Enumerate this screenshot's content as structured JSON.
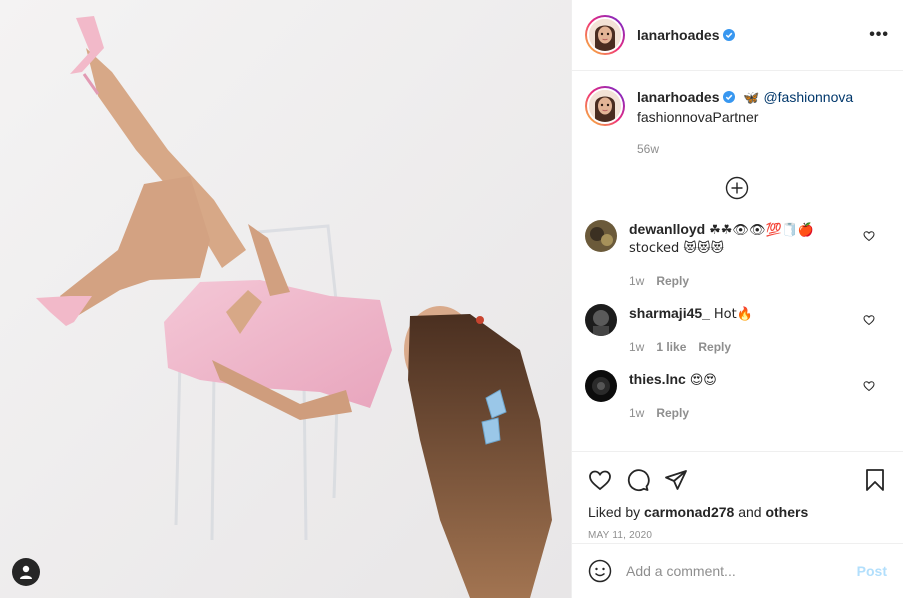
{
  "post": {
    "author": "lanarhoades",
    "more_label": "•••",
    "user_tag_icon": "user-silhouette-icon"
  },
  "caption": {
    "author": "lanarhoades",
    "emoji": "🦋",
    "mention": "@fashionnova",
    "partner": "fashionnovaPartner",
    "age": "56w"
  },
  "comments": [
    {
      "user": "dewanlloyd",
      "text_line1": "☘☘👁👁💯🧻🍎",
      "text_line2": "stocked 😻😻😻",
      "age": "1w",
      "likes": "",
      "reply": "Reply"
    },
    {
      "user": "sharmaji45_",
      "text": "Hot🔥",
      "age": "1w",
      "likes": "1 like",
      "reply": "Reply"
    },
    {
      "user": "thies.lnc",
      "text": "😍😍",
      "age": "1w",
      "likes": "",
      "reply": "Reply"
    }
  ],
  "likes": {
    "prefix": "Liked by",
    "user": "carmonad278",
    "joiner": "and",
    "suffix": "others"
  },
  "date": "MAY 11, 2020",
  "composer": {
    "placeholder": "Add a comment...",
    "post_label": "Post"
  },
  "colors": {
    "verified": "#3897f0",
    "mention": "#00376b",
    "post_disabled": "#b2dffc",
    "muted": "#8e8e8e"
  }
}
